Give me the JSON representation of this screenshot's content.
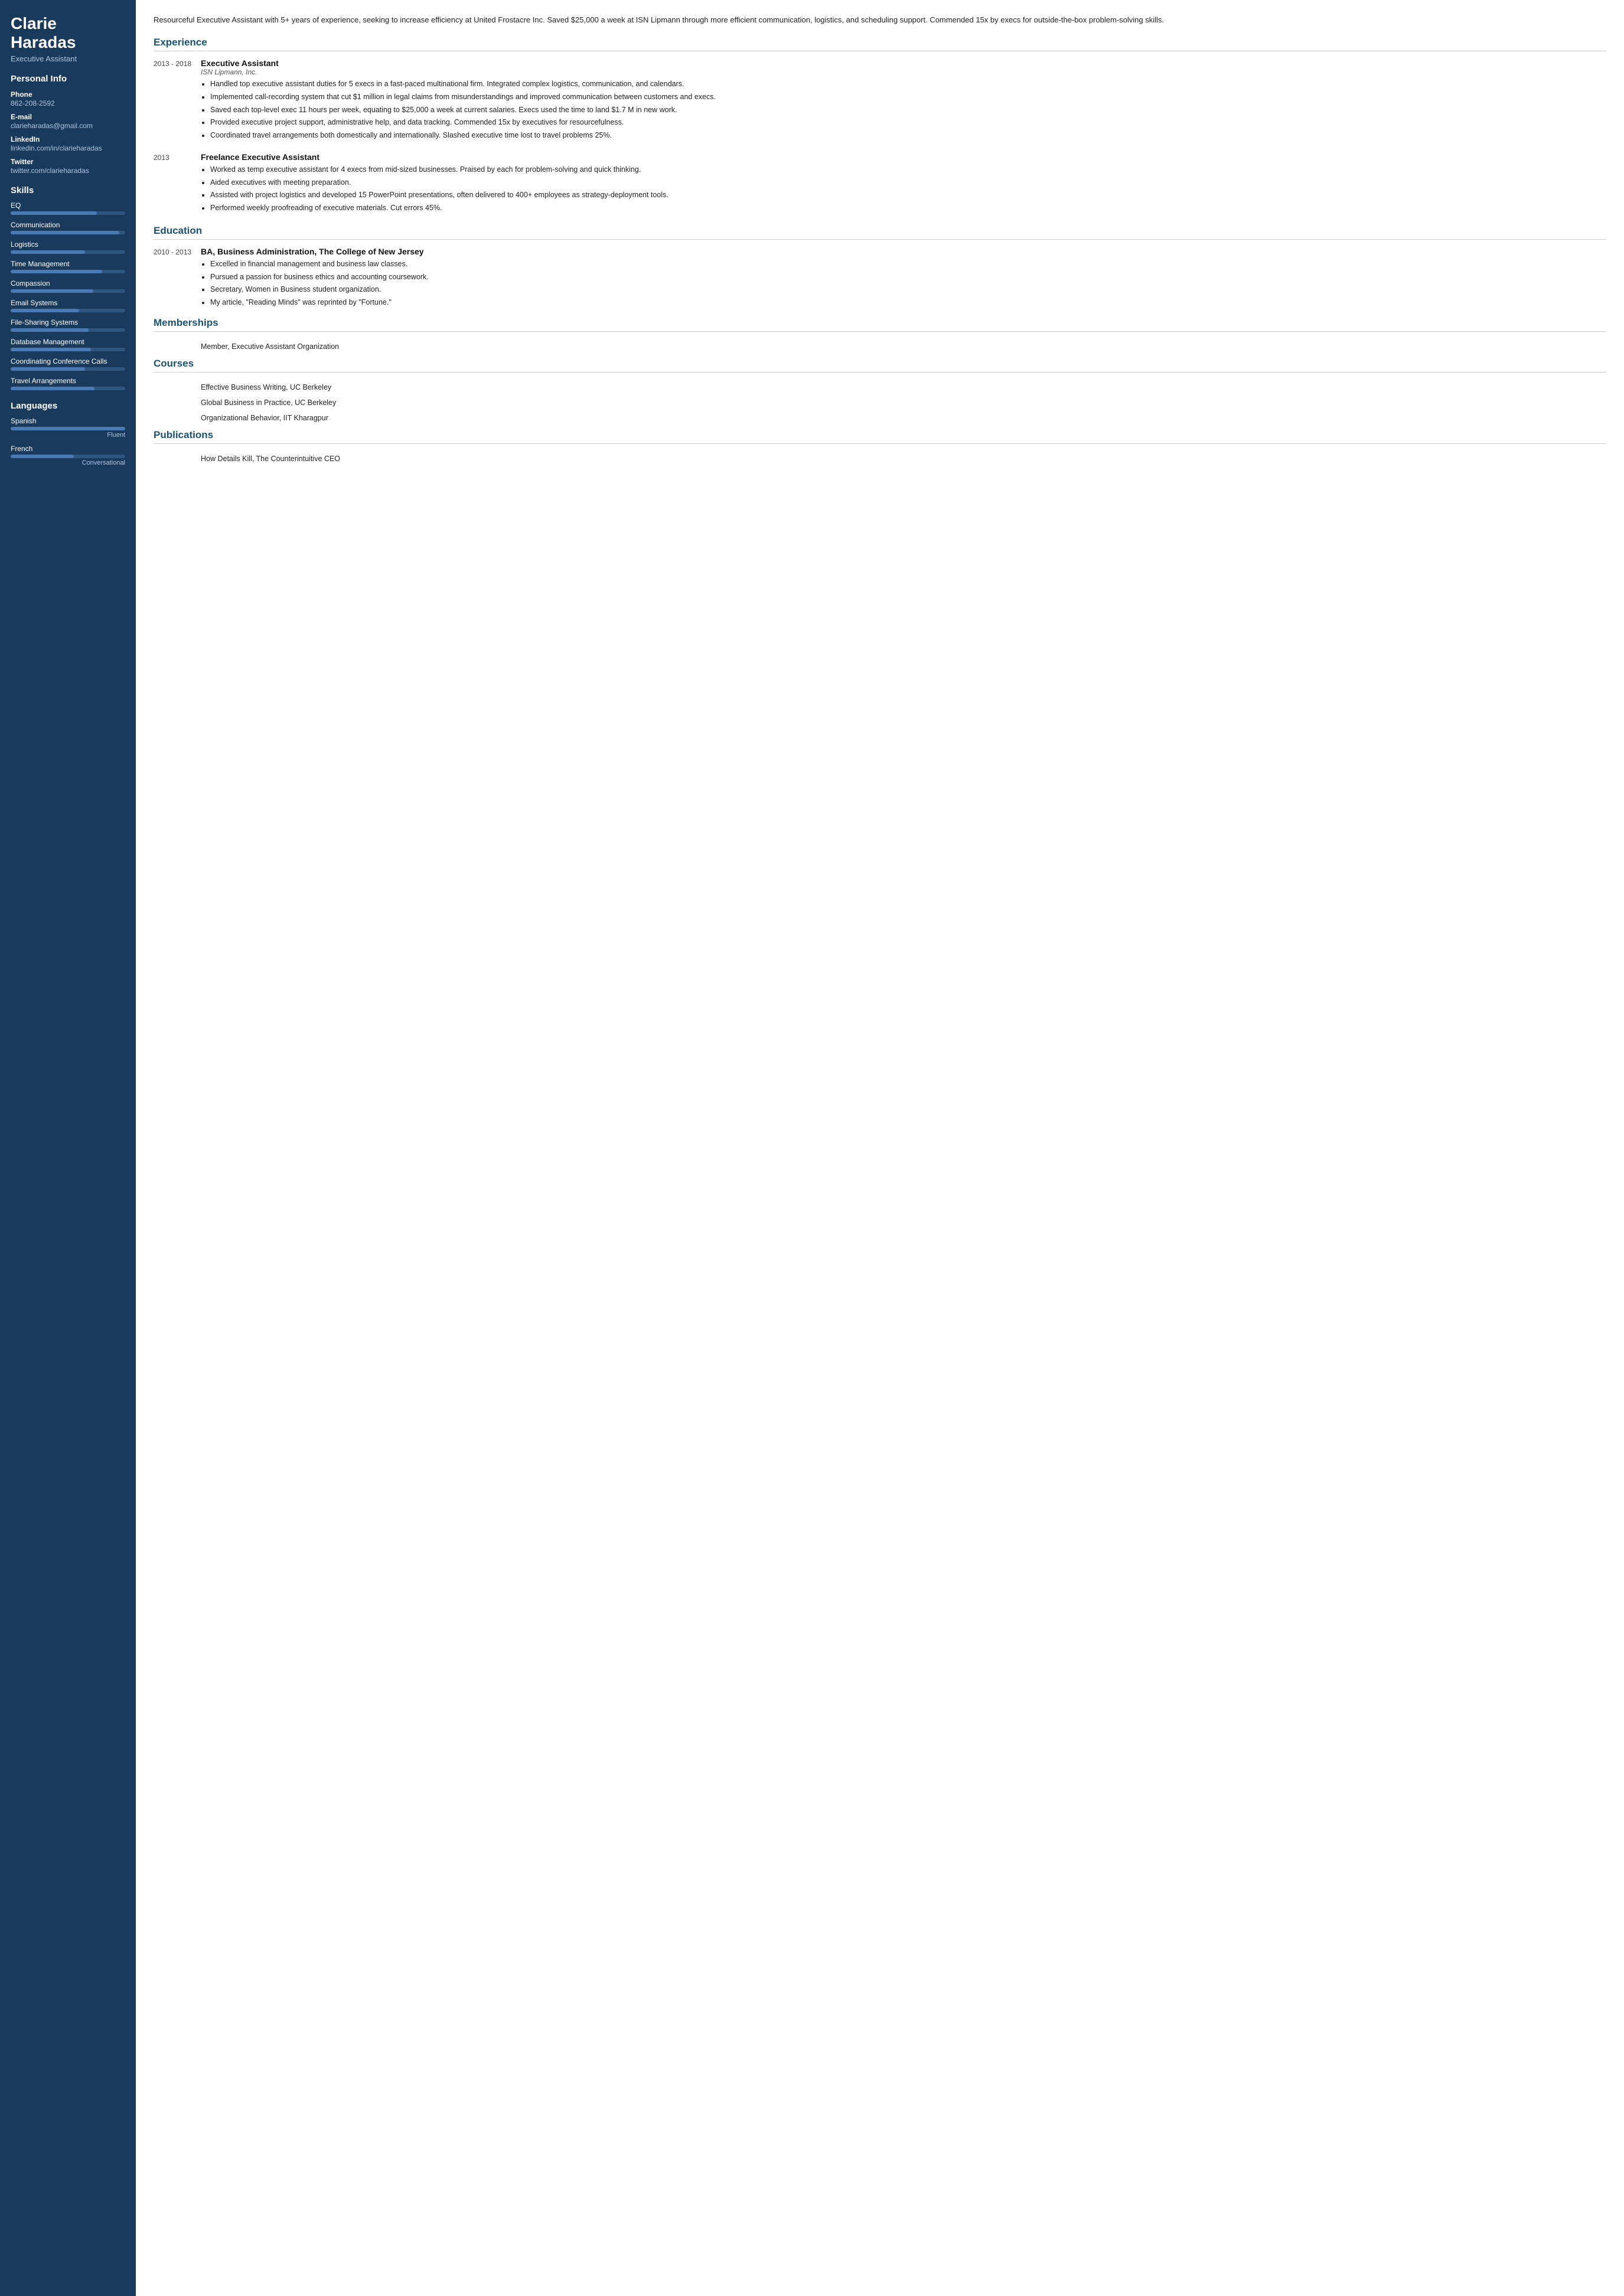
{
  "sidebar": {
    "name": "Clarie Haradas",
    "title": "Executive Assistant",
    "personal_info_section": "Personal Info",
    "personal_info": [
      {
        "label": "Phone",
        "value": "862-208-2592"
      },
      {
        "label": "E-mail",
        "value": "clarieharadas@gmail.com"
      },
      {
        "label": "LinkedIn",
        "value": "linkedin.com/in/clarieharadas"
      },
      {
        "label": "Twitter",
        "value": "twitter.com/clarieharadas"
      }
    ],
    "skills_section": "Skills",
    "skills": [
      {
        "name": "EQ",
        "fill": 75
      },
      {
        "name": "Communication",
        "fill": 95
      },
      {
        "name": "Logistics",
        "fill": 65
      },
      {
        "name": "Time Management",
        "fill": 80
      },
      {
        "name": "Compassion",
        "fill": 72
      },
      {
        "name": "Email Systems",
        "fill": 60
      },
      {
        "name": "File-Sharing Systems",
        "fill": 68
      },
      {
        "name": "Database Management",
        "fill": 70
      },
      {
        "name": "Coordinating Conference Calls",
        "fill": 65
      },
      {
        "name": "Travel Arrangements",
        "fill": 73
      }
    ],
    "languages_section": "Languages",
    "languages": [
      {
        "name": "Spanish",
        "fill": 100,
        "level": "Fluent"
      },
      {
        "name": "French",
        "fill": 55,
        "level": "Conversational"
      }
    ]
  },
  "main": {
    "summary": "Resourceful Executive Assistant with 5+ years of experience, seeking to increase efficiency at United Frostacre Inc. Saved $25,000 a week at ISN Lipmann through more efficient communication, logistics, and scheduling support. Commended 15x by execs for outside-the-box problem-solving skills.",
    "experience_title": "Experience",
    "experience": [
      {
        "date": "2013 - 2018",
        "title": "Executive Assistant",
        "company": "ISN Lipmann, Inc.",
        "bullets": [
          "Handled top executive assistant duties for 5 execs in a fast-paced multinational firm. Integrated complex logistics, communication, and calendars.",
          "Implemented call-recording system that cut $1 million in legal claims from misunderstandings and improved communication between customers and execs.",
          "Saved each top-level exec 11 hours per week, equating to $25,000 a week at current salaries. Execs used the time to land $1.7 M in new work.",
          "Provided executive project support, administrative help, and data tracking. Commended 15x by executives for resourcefulness.",
          "Coordinated travel arrangements both domestically and internationally. Slashed executive time lost to travel problems 25%."
        ]
      },
      {
        "date": "2013",
        "title": "Freelance Executive Assistant",
        "company": "",
        "bullets": [
          "Worked as temp executive assistant for 4 execs from mid-sized businesses. Praised by each for problem-solving and quick thinking.",
          "Aided executives with meeting preparation.",
          "Assisted with project logistics and developed 15 PowerPoint presentations, often delivered to 400+ employees as strategy-deployment tools.",
          "Performed weekly proofreading of executive materials. Cut errors 45%."
        ]
      }
    ],
    "education_title": "Education",
    "education": [
      {
        "date": "2010 - 2013",
        "degree": "BA, Business Administration, The College of New Jersey",
        "bullets": [
          "Excelled in financial management and business law classes.",
          "Pursued a passion for business ethics and accounting coursework.",
          "Secretary, Women in Business student organization.",
          "My article, \"Reading Minds\" was reprinted by \"Fortune.\""
        ]
      }
    ],
    "memberships_title": "Memberships",
    "memberships": [
      "Member, Executive Assistant Organization"
    ],
    "courses_title": "Courses",
    "courses": [
      "Effective Business Writing, UC Berkeley",
      "Global Business in Practice, UC Berkeley",
      "Organizational Behavior, IIT Kharagpur"
    ],
    "publications_title": "Publications",
    "publications": [
      "How Details Kill, The Counterintuitive CEO"
    ]
  }
}
